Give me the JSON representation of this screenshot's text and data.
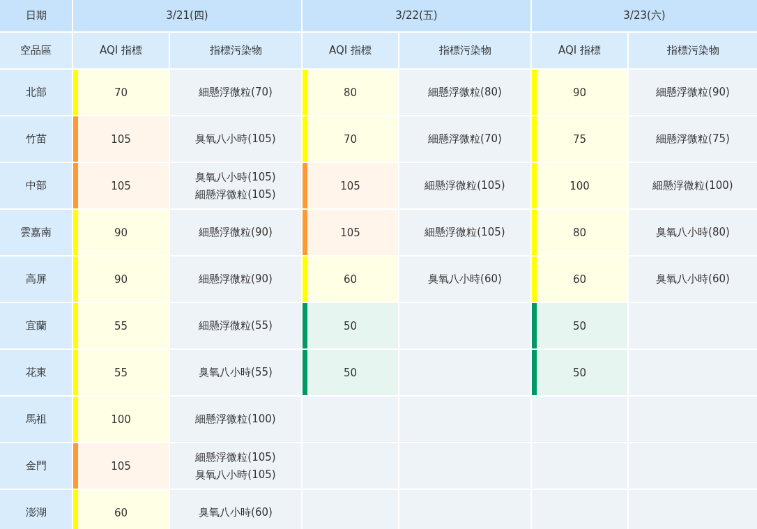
{
  "table": {
    "date_label": "日期",
    "region_label": "空品區",
    "dates": [
      "3/21(四)",
      "3/22(五)",
      "3/23(六)"
    ],
    "subheaders": [
      [
        "AQI 指標",
        "指標污染物"
      ],
      [
        "AQI 指標",
        "指標污染物"
      ],
      [
        "AQI 指標",
        "指標污染物"
      ]
    ],
    "rows": [
      {
        "region": "北部",
        "days": [
          {
            "aqi": "70",
            "color": "#ffff00",
            "pollutants": [
              "細懸浮微粒(70)"
            ]
          },
          {
            "aqi": "80",
            "color": "#ffff00",
            "pollutants": [
              "細懸浮微粒(80)"
            ]
          },
          {
            "aqi": "90",
            "color": "#ffff00",
            "pollutants": [
              "細懸浮微粒(90)"
            ]
          }
        ]
      },
      {
        "region": "竹苗",
        "days": [
          {
            "aqi": "105",
            "color": "#ff9933",
            "pollutants": [
              "臭氧八小時(105)"
            ]
          },
          {
            "aqi": "70",
            "color": "#ffff00",
            "pollutants": [
              "細懸浮微粒(70)"
            ]
          },
          {
            "aqi": "75",
            "color": "#ffff00",
            "pollutants": [
              "細懸浮微粒(75)"
            ]
          }
        ]
      },
      {
        "region": "中部",
        "days": [
          {
            "aqi": "105",
            "color": "#ff9933",
            "pollutants": [
              "臭氧八小時(105)",
              "細懸浮微粒(105)"
            ]
          },
          {
            "aqi": "105",
            "color": "#ff9933",
            "pollutants": [
              "細懸浮微粒(105)"
            ]
          },
          {
            "aqi": "100",
            "color": "#ffff00",
            "pollutants": [
              "細懸浮微粒(100)"
            ]
          }
        ]
      },
      {
        "region": "雲嘉南",
        "days": [
          {
            "aqi": "90",
            "color": "#ffff00",
            "pollutants": [
              "細懸浮微粒(90)"
            ]
          },
          {
            "aqi": "105",
            "color": "#ff9933",
            "pollutants": [
              "細懸浮微粒(105)"
            ]
          },
          {
            "aqi": "80",
            "color": "#ffff00",
            "pollutants": [
              "臭氧八小時(80)"
            ]
          }
        ]
      },
      {
        "region": "高屏",
        "days": [
          {
            "aqi": "90",
            "color": "#ffff00",
            "pollutants": [
              "細懸浮微粒(90)"
            ]
          },
          {
            "aqi": "60",
            "color": "#ffff00",
            "pollutants": [
              "臭氧八小時(60)"
            ]
          },
          {
            "aqi": "60",
            "color": "#ffff00",
            "pollutants": [
              "臭氧八小時(60)"
            ]
          }
        ]
      },
      {
        "region": "宜蘭",
        "days": [
          {
            "aqi": "55",
            "color": "#ffff00",
            "pollutants": [
              "細懸浮微粒(55)"
            ]
          },
          {
            "aqi": "50",
            "color": "#009865"
          },
          {
            "aqi": "50",
            "color": "#009865"
          }
        ]
      },
      {
        "region": "花東",
        "days": [
          {
            "aqi": "55",
            "color": "#ffff00",
            "pollutants": [
              "臭氧八小時(55)"
            ]
          },
          {
            "aqi": "50",
            "color": "#009865"
          },
          {
            "aqi": "50",
            "color": "#009865"
          }
        ]
      },
      {
        "region": "馬祖",
        "days": [
          {
            "aqi": "100",
            "color": "#ffff00",
            "pollutants": [
              "細懸浮微粒(100)"
            ]
          }
        ]
      },
      {
        "region": "金門",
        "days": [
          {
            "aqi": "105",
            "color": "#ff9933",
            "pollutants": [
              "細懸浮微粒(105)",
              "臭氧八小時(105)"
            ]
          }
        ]
      },
      {
        "region": "澎湖",
        "days": [
          {
            "aqi": "60",
            "color": "#ffff00",
            "pollutants": [
              "臭氧八小時(60)"
            ]
          }
        ]
      }
    ]
  }
}
